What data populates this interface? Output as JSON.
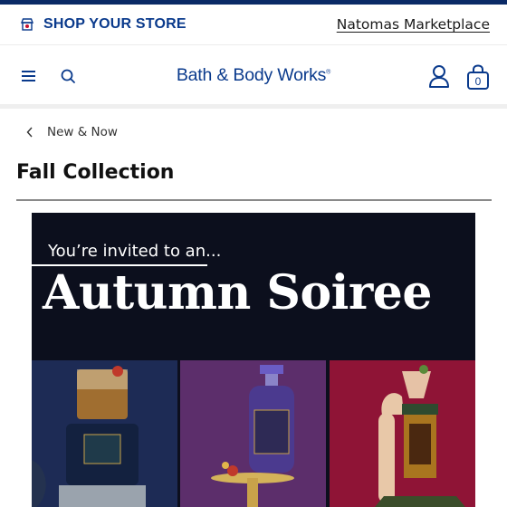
{
  "store_bar": {
    "title": "SHOP YOUR STORE",
    "store_name": "Natomas Marketplace",
    "icon": "store-icon"
  },
  "header": {
    "logo_text": "Bath & Body Works",
    "logo_mark": "®",
    "bag_count": "0",
    "icons": [
      "menu-icon",
      "search-icon",
      "account-icon",
      "bag-icon"
    ]
  },
  "breadcrumb": {
    "label": "New & Now",
    "icon": "chevron-left-icon"
  },
  "page": {
    "title": "Fall Collection"
  },
  "banner": {
    "subtitle": "You’re invited to an...",
    "headline": "Autumn Soiree"
  },
  "colors": {
    "brand_blue": "#0a3a8c",
    "top_strip": "#0a2a66",
    "banner_bg": "#0c0f1d",
    "panel_blue": "#1d2b55",
    "panel_purple": "#5c2e6b",
    "panel_red": "#8f1436"
  }
}
